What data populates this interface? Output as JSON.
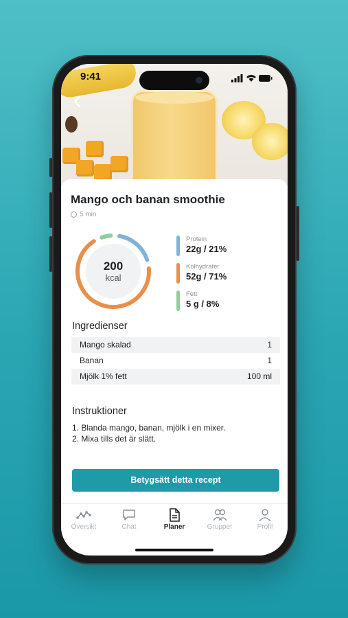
{
  "status_bar": {
    "time": "9:41"
  },
  "recipe": {
    "title": "Mango och banan smoothie",
    "duration": "5 min",
    "calories": {
      "value": "200",
      "unit": "kcal"
    },
    "macros": [
      {
        "label": "Protein",
        "value": "22g / 21%",
        "color": "#7fb3d8",
        "percent": 21
      },
      {
        "label": "Kolhydrater",
        "value": "52g / 71%",
        "color": "#e8904a",
        "percent": 71
      },
      {
        "label": "Fett",
        "value": "5 g / 8%",
        "color": "#8fcf9c",
        "percent": 8
      }
    ]
  },
  "ingredients": {
    "title": "Ingredienser",
    "items": [
      {
        "name": "Mango skalad",
        "amount": "1"
      },
      {
        "name": "Banan",
        "amount": "1"
      },
      {
        "name": "Mjölk 1% fett",
        "amount": "100 ml"
      }
    ]
  },
  "instructions": {
    "title": "Instruktioner",
    "steps": [
      "1. Blanda mango, banan, mjölk i en mixer.",
      "2. Mixa tills det är slätt."
    ]
  },
  "actions": {
    "rate_label": "Betygsätt detta recept"
  },
  "tabbar": {
    "items": [
      {
        "label": "Översikt",
        "icon": "overview-icon",
        "active": false
      },
      {
        "label": "Chat",
        "icon": "chat-icon",
        "active": false
      },
      {
        "label": "Planer",
        "icon": "document-icon",
        "active": true
      },
      {
        "label": "Grupper",
        "icon": "group-icon",
        "active": false
      },
      {
        "label": "Profil",
        "icon": "profile-icon",
        "active": false
      }
    ]
  }
}
